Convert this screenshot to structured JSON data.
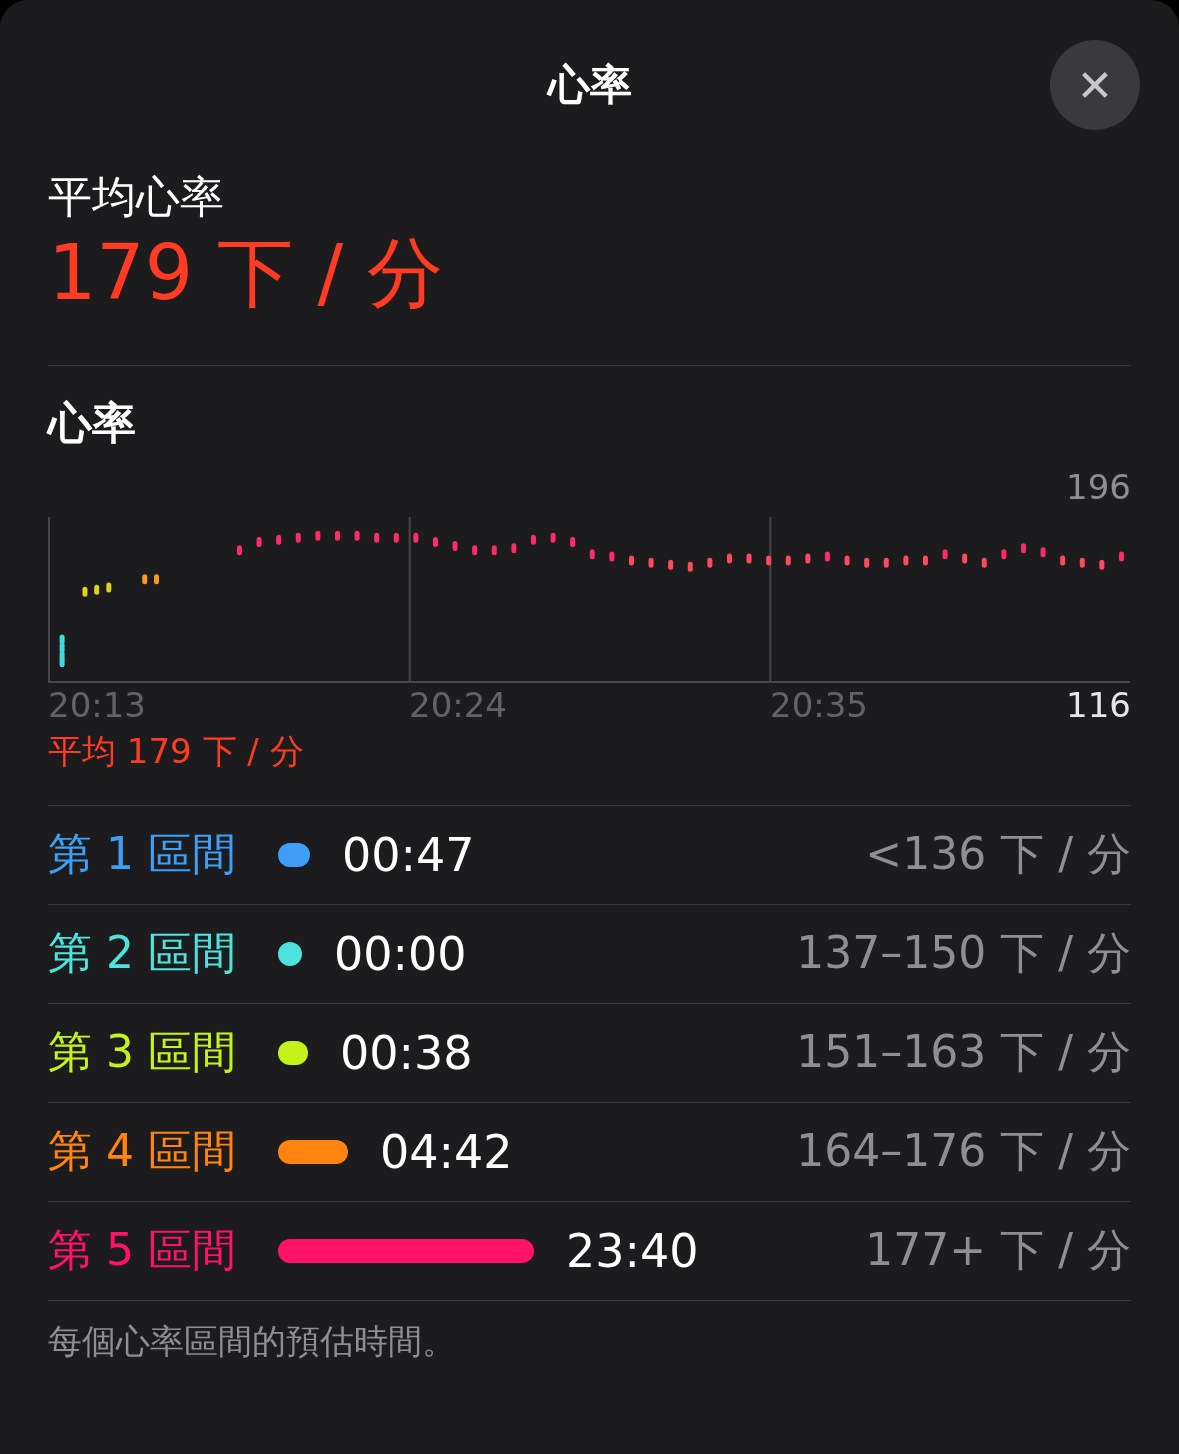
{
  "title": "心率",
  "close": {
    "label": "✕"
  },
  "average": {
    "label": "平均心率",
    "value": "179 下 / 分"
  },
  "heart_rate": {
    "title": "心率",
    "max_reading": "196",
    "time_labels": [
      "20:13",
      "20:24",
      "20:35"
    ],
    "min_reading": "116",
    "average_note": "平均 179 下 / 分"
  },
  "zones": [
    {
      "label": "第 1 區間",
      "color": "#3f9ef5",
      "time": "00:47",
      "range": "<136 下 / 分"
    },
    {
      "label": "第 2 區間",
      "color": "#4de3dc",
      "time": "00:00",
      "range": "137–150 下 / 分"
    },
    {
      "label": "第 3 區間",
      "color": "#c4f21a",
      "time": "00:38",
      "range": "151–163 下 / 分"
    },
    {
      "label": "第 4 區間",
      "color": "#ff8410",
      "time": "04:42",
      "range": "164–176 下 / 分"
    },
    {
      "label": "第 5 區間",
      "color": "#ff1368",
      "time": "23:40",
      "range": "177+ 下 / 分"
    }
  ],
  "footnote": "每個心率區間的預估時間。"
}
